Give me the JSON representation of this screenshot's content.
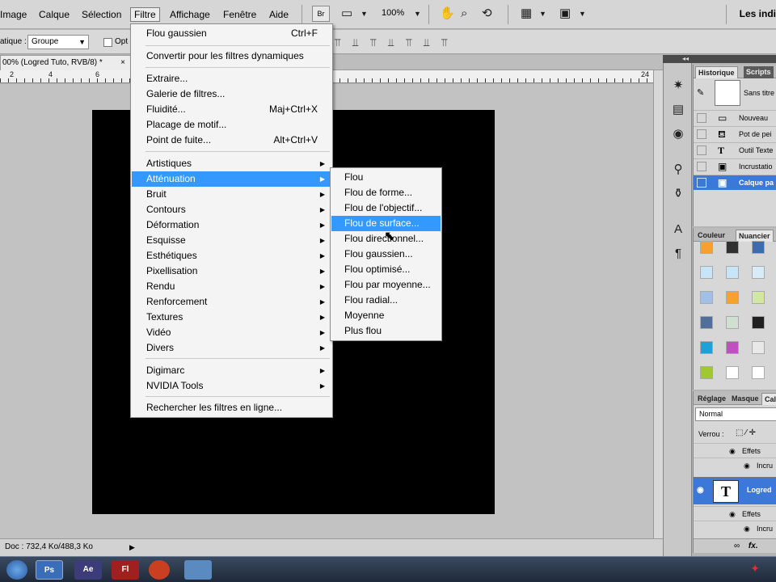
{
  "menubar": {
    "items": [
      "Image",
      "Calque",
      "Sélection",
      "Filtre",
      "Affichage",
      "Fenêtre",
      "Aide"
    ],
    "br_badge": "Br",
    "zoom": "100%",
    "workspace": "Les indi"
  },
  "options": {
    "label": "atique :",
    "select_value": "Groupe",
    "checkbox_label": "Opt"
  },
  "document": {
    "tab_title": "00% (Logred Tuto, RVB/8) *",
    "close": "×",
    "status": "Doc : 732,4 Ko/488,3 Ko"
  },
  "ruler": {
    "labels": [
      "2",
      "4",
      "6",
      "24"
    ]
  },
  "filter_menu": {
    "items": [
      {
        "label": "Flou gaussien",
        "shortcut": "Ctrl+F"
      },
      {
        "label": "Convertir pour les filtres dynamiques"
      },
      {
        "label": "Extraire..."
      },
      {
        "label": "Galerie de filtres..."
      },
      {
        "label": "Fluidité...",
        "shortcut": "Maj+Ctrl+X"
      },
      {
        "label": "Placage de motif..."
      },
      {
        "label": "Point de fuite...",
        "shortcut": "Alt+Ctrl+V"
      },
      {
        "label": "Artistiques"
      },
      {
        "label": "Atténuation"
      },
      {
        "label": "Bruit"
      },
      {
        "label": "Contours"
      },
      {
        "label": "Déformation"
      },
      {
        "label": "Esquisse"
      },
      {
        "label": "Esthétiques"
      },
      {
        "label": "Pixellisation"
      },
      {
        "label": "Rendu"
      },
      {
        "label": "Renforcement"
      },
      {
        "label": "Textures"
      },
      {
        "label": "Vidéo"
      },
      {
        "label": "Divers"
      },
      {
        "label": "Digimarc"
      },
      {
        "label": "NVIDIA Tools"
      },
      {
        "label": "Rechercher les filtres en ligne..."
      }
    ]
  },
  "submenu": {
    "items": [
      "Flou",
      "Flou de forme...",
      "Flou de l'objectif...",
      "Flou de surface...",
      "Flou directionnel...",
      "Flou gaussien...",
      "Flou optimisé...",
      "Flou par moyenne...",
      "Flou radial...",
      "Moyenne",
      "Plus flou"
    ]
  },
  "history": {
    "tabs": [
      "Historique",
      "Scripts"
    ],
    "snapshot": "Sans titre",
    "rows": [
      "Nouveau",
      "Pot de pei",
      "Outil Texte",
      "Incrustatio",
      "Calque pa"
    ]
  },
  "swatches": {
    "tabs": [
      "Couleur",
      "Nuancier"
    ],
    "colors": [
      "#f7a030",
      "#303030",
      "#3a6db0",
      "#ffffff",
      "#c8e4f8",
      "#c8e4f8",
      "#d8ecf8",
      "#ffffff",
      "#a0c0e8",
      "#f8a030",
      "#d0e8a0",
      "#f0f0f0",
      "#50709a",
      "#d0e0d0",
      "#202020",
      "#ffffff",
      "#20a0d8",
      "#c050c0",
      "#e8e8e8",
      "#ffffff",
      "#a0c830",
      "#ffffff",
      "#ffffff",
      "#ffffff"
    ]
  },
  "layers": {
    "tabs": [
      "Réglage",
      "Masque",
      "Cal"
    ],
    "blend_mode": "Normal",
    "lock_label": "Verrou :",
    "effects": "Effets",
    "incrust": "Incru",
    "layer_name": "Logred",
    "layer_type": "T",
    "footer_label": "fx."
  },
  "taskbar": {
    "buttons": [
      "Ps",
      "Ae",
      "Fl",
      "",
      ""
    ]
  }
}
